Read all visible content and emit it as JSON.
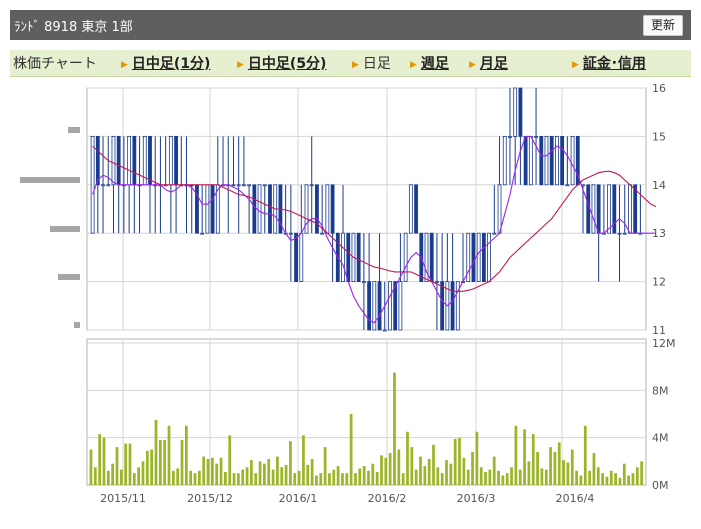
{
  "header": {
    "title": "ﾗﾝﾄﾞ 8918 東京 1部",
    "refresh_label": "更新"
  },
  "tabs": [
    {
      "label": "株価チャート",
      "link": false,
      "arrow": false
    },
    {
      "label": "日中足(1分)",
      "link": true,
      "arrow": true
    },
    {
      "label": "日中足(5分)",
      "link": true,
      "arrow": true
    },
    {
      "label": "日足",
      "link": false,
      "arrow": true
    },
    {
      "label": "週足",
      "link": true,
      "arrow": true
    },
    {
      "label": "月足",
      "link": true,
      "arrow": true
    },
    {
      "label": "証金･信用",
      "link": true,
      "arrow": true
    }
  ],
  "chart_data": [
    {
      "type": "candlestick",
      "title": "",
      "ylim": [
        11,
        16
      ],
      "y_ticks": [
        "11",
        "12",
        "13",
        "14",
        "15",
        "16"
      ],
      "grid": true,
      "colors": {
        "up": "#ffffff",
        "down": "#1a3c8e",
        "border": "#1a3c8e",
        "ma_short": "#c2185b",
        "ma_long": "#a020f0"
      },
      "candles": [
        {
          "o": 13,
          "h": 15,
          "l": 13,
          "c": 15
        },
        {
          "o": 15,
          "h": 15,
          "l": 13,
          "c": 14
        },
        {
          "o": 14,
          "h": 15,
          "l": 13,
          "c": 14
        },
        {
          "o": 14,
          "h": 15,
          "l": 14,
          "c": 14
        },
        {
          "o": 14,
          "h": 15,
          "l": 13,
          "c": 15
        },
        {
          "o": 15,
          "h": 15,
          "l": 13,
          "c": 14
        },
        {
          "o": 14,
          "h": 15,
          "l": 13,
          "c": 14
        },
        {
          "o": 14,
          "h": 15,
          "l": 13,
          "c": 15
        },
        {
          "o": 15,
          "h": 15,
          "l": 13,
          "c": 14
        },
        {
          "o": 14,
          "h": 15,
          "l": 13,
          "c": 14
        },
        {
          "o": 14,
          "h": 15,
          "l": 14,
          "c": 15
        },
        {
          "o": 15,
          "h": 15,
          "l": 13,
          "c": 14
        },
        {
          "o": 14,
          "h": 15,
          "l": 13,
          "c": 14
        },
        {
          "o": 14,
          "h": 15,
          "l": 13,
          "c": 14
        },
        {
          "o": 14,
          "h": 15,
          "l": 14,
          "c": 14
        },
        {
          "o": 14,
          "h": 15,
          "l": 13,
          "c": 15
        },
        {
          "o": 15,
          "h": 15,
          "l": 13,
          "c": 14
        },
        {
          "o": 14,
          "h": 15,
          "l": 14,
          "c": 14
        },
        {
          "o": 14,
          "h": 15,
          "l": 13,
          "c": 14
        },
        {
          "o": 14,
          "h": 14,
          "l": 13,
          "c": 14
        },
        {
          "o": 14,
          "h": 14,
          "l": 13,
          "c": 13
        },
        {
          "o": 13,
          "h": 14,
          "l": 13,
          "c": 13
        },
        {
          "o": 13,
          "h": 14,
          "l": 13,
          "c": 14
        },
        {
          "o": 14,
          "h": 14,
          "l": 13,
          "c": 13
        },
        {
          "o": 13,
          "h": 15,
          "l": 13,
          "c": 14
        },
        {
          "o": 14,
          "h": 15,
          "l": 14,
          "c": 14
        },
        {
          "o": 14,
          "h": 15,
          "l": 13,
          "c": 14
        },
        {
          "o": 14,
          "h": 15,
          "l": 14,
          "c": 14
        },
        {
          "o": 14,
          "h": 15,
          "l": 13,
          "c": 14
        },
        {
          "o": 14,
          "h": 15,
          "l": 14,
          "c": 14
        },
        {
          "o": 14,
          "h": 14,
          "l": 13,
          "c": 14
        },
        {
          "o": 14,
          "h": 14,
          "l": 13,
          "c": 13
        },
        {
          "o": 13,
          "h": 14,
          "l": 13,
          "c": 14
        },
        {
          "o": 14,
          "h": 14,
          "l": 13,
          "c": 14
        },
        {
          "o": 14,
          "h": 14,
          "l": 13,
          "c": 13
        },
        {
          "o": 13,
          "h": 14,
          "l": 13,
          "c": 14
        },
        {
          "o": 14,
          "h": 14,
          "l": 13,
          "c": 13
        },
        {
          "o": 13,
          "h": 14,
          "l": 13,
          "c": 13
        },
        {
          "o": 13,
          "h": 14,
          "l": 12,
          "c": 13
        },
        {
          "o": 13,
          "h": 13,
          "l": 12,
          "c": 12
        },
        {
          "o": 12,
          "h": 14,
          "l": 12,
          "c": 13
        },
        {
          "o": 13,
          "h": 14,
          "l": 13,
          "c": 14
        },
        {
          "o": 14,
          "h": 15,
          "l": 13,
          "c": 14
        },
        {
          "o": 14,
          "h": 14,
          "l": 13,
          "c": 13
        },
        {
          "o": 13,
          "h": 14,
          "l": 13,
          "c": 13
        },
        {
          "o": 13,
          "h": 14,
          "l": 13,
          "c": 14
        },
        {
          "o": 14,
          "h": 14,
          "l": 12,
          "c": 13
        },
        {
          "o": 13,
          "h": 13,
          "l": 12,
          "c": 12
        },
        {
          "o": 12,
          "h": 14,
          "l": 12,
          "c": 13
        },
        {
          "o": 13,
          "h": 13,
          "l": 12,
          "c": 12
        },
        {
          "o": 12,
          "h": 13,
          "l": 12,
          "c": 13
        },
        {
          "o": 13,
          "h": 13,
          "l": 12,
          "c": 12
        },
        {
          "o": 12,
          "h": 13,
          "l": 11,
          "c": 12
        },
        {
          "o": 12,
          "h": 13,
          "l": 11,
          "c": 11
        },
        {
          "o": 11,
          "h": 12,
          "l": 11,
          "c": 12
        },
        {
          "o": 12,
          "h": 13,
          "l": 11,
          "c": 11
        },
        {
          "o": 11,
          "h": 12,
          "l": 11,
          "c": 11
        },
        {
          "o": 11,
          "h": 12,
          "l": 11,
          "c": 12
        },
        {
          "o": 12,
          "h": 12,
          "l": 11,
          "c": 11
        },
        {
          "o": 11,
          "h": 13,
          "l": 11,
          "c": 12
        },
        {
          "o": 12,
          "h": 13,
          "l": 12,
          "c": 13
        },
        {
          "o": 13,
          "h": 14,
          "l": 13,
          "c": 14
        },
        {
          "o": 14,
          "h": 14,
          "l": 13,
          "c": 13
        },
        {
          "o": 13,
          "h": 13,
          "l": 12,
          "c": 12
        },
        {
          "o": 12,
          "h": 13,
          "l": 12,
          "c": 13
        },
        {
          "o": 13,
          "h": 13,
          "l": 12,
          "c": 12
        },
        {
          "o": 12,
          "h": 13,
          "l": 11,
          "c": 12
        },
        {
          "o": 12,
          "h": 13,
          "l": 11,
          "c": 11
        },
        {
          "o": 11,
          "h": 13,
          "l": 11,
          "c": 12
        },
        {
          "o": 12,
          "h": 13,
          "l": 11,
          "c": 11
        },
        {
          "o": 11,
          "h": 12,
          "l": 11,
          "c": 12
        },
        {
          "o": 12,
          "h": 13,
          "l": 12,
          "c": 12
        },
        {
          "o": 12,
          "h": 13,
          "l": 12,
          "c": 13
        },
        {
          "o": 13,
          "h": 13,
          "l": 12,
          "c": 12
        },
        {
          "o": 12,
          "h": 13,
          "l": 12,
          "c": 13
        },
        {
          "o": 13,
          "h": 13,
          "l": 12,
          "c": 12
        },
        {
          "o": 12,
          "h": 13,
          "l": 12,
          "c": 13
        },
        {
          "o": 13,
          "h": 14,
          "l": 13,
          "c": 13
        },
        {
          "o": 13,
          "h": 15,
          "l": 13,
          "c": 14
        },
        {
          "o": 14,
          "h": 15,
          "l": 14,
          "c": 15
        },
        {
          "o": 15,
          "h": 16,
          "l": 14,
          "c": 15
        },
        {
          "o": 15,
          "h": 16,
          "l": 14,
          "c": 16
        },
        {
          "o": 16,
          "h": 16,
          "l": 14,
          "c": 15
        },
        {
          "o": 15,
          "h": 15,
          "l": 14,
          "c": 14
        },
        {
          "o": 14,
          "h": 15,
          "l": 14,
          "c": 15
        },
        {
          "o": 15,
          "h": 16,
          "l": 14,
          "c": 15
        },
        {
          "o": 15,
          "h": 15,
          "l": 14,
          "c": 14
        },
        {
          "o": 14,
          "h": 15,
          "l": 14,
          "c": 15
        },
        {
          "o": 15,
          "h": 15,
          "l": 14,
          "c": 14
        },
        {
          "o": 14,
          "h": 15,
          "l": 14,
          "c": 15
        },
        {
          "o": 15,
          "h": 15,
          "l": 14,
          "c": 14
        },
        {
          "o": 14,
          "h": 15,
          "l": 14,
          "c": 14
        },
        {
          "o": 14,
          "h": 15,
          "l": 14,
          "c": 15
        },
        {
          "o": 15,
          "h": 15,
          "l": 14,
          "c": 14
        },
        {
          "o": 14,
          "h": 14,
          "l": 13,
          "c": 14
        },
        {
          "o": 14,
          "h": 14,
          "l": 13,
          "c": 13
        },
        {
          "o": 13,
          "h": 14,
          "l": 13,
          "c": 14
        },
        {
          "o": 14,
          "h": 14,
          "l": 12,
          "c": 13
        },
        {
          "o": 13,
          "h": 14,
          "l": 13,
          "c": 13
        },
        {
          "o": 13,
          "h": 14,
          "l": 13,
          "c": 14
        },
        {
          "o": 14,
          "h": 14,
          "l": 13,
          "c": 13
        },
        {
          "o": 13,
          "h": 14,
          "l": 12,
          "c": 13
        },
        {
          "o": 13,
          "h": 14,
          "l": 13,
          "c": 13
        },
        {
          "o": 13,
          "h": 14,
          "l": 13,
          "c": 14
        },
        {
          "o": 14,
          "h": 14,
          "l": 13,
          "c": 13
        },
        {
          "o": 13,
          "h": 14,
          "l": 13,
          "c": 13
        }
      ],
      "ma_short": [
        14.8,
        14.7,
        14.6,
        14.5,
        14.45,
        14.4,
        14.35,
        14.3,
        14.25,
        14.2,
        14.15,
        14.1,
        14.05,
        14.0,
        14.0,
        14.0,
        14.0,
        14.0,
        14.0,
        14.0,
        14.0,
        14.0,
        14.0,
        14.0,
        14.0,
        13.95,
        13.9,
        13.85,
        13.8,
        13.78,
        13.75,
        13.7,
        13.65,
        13.6,
        13.55,
        13.5,
        13.5,
        13.48,
        13.45,
        13.4,
        13.35,
        13.3,
        13.25,
        13.2,
        13.1,
        13.0,
        12.9,
        12.8,
        12.7,
        12.6,
        12.5,
        12.45,
        12.4,
        12.35,
        12.3,
        12.28,
        12.25,
        12.22,
        12.2,
        12.2,
        12.2,
        12.2,
        12.15,
        12.1,
        12.05,
        12.0,
        11.95,
        11.9,
        11.85,
        11.8,
        11.8,
        11.8,
        11.82,
        11.85,
        11.9,
        11.95,
        12.0,
        12.1,
        12.2,
        12.35,
        12.5,
        12.6,
        12.7,
        12.8,
        12.9,
        13.0,
        13.1,
        13.2,
        13.3,
        13.45,
        13.6,
        13.75,
        13.9,
        14.0,
        14.1,
        14.15,
        14.2,
        14.25,
        14.27,
        14.28,
        14.25,
        14.2,
        14.1,
        14.0,
        13.9,
        13.8,
        13.7,
        13.6,
        13.55
      ],
      "ma_long": [
        13.8,
        14.1,
        14.2,
        14.15,
        14.05,
        14.0,
        14.0,
        14.0,
        14.0,
        14.0,
        14.0,
        14.0,
        14.0,
        14.0,
        13.9,
        13.85,
        13.9,
        14.0,
        14.0,
        13.95,
        13.8,
        13.6,
        13.6,
        13.7,
        13.9,
        14.0,
        14.0,
        13.95,
        13.9,
        13.8,
        13.7,
        13.55,
        13.45,
        13.4,
        13.4,
        13.35,
        13.2,
        13.0,
        12.85,
        12.9,
        13.0,
        13.2,
        13.3,
        13.3,
        13.15,
        12.9,
        12.7,
        12.5,
        12.35,
        12.0,
        11.7,
        11.5,
        11.35,
        11.2,
        11.15,
        11.3,
        11.5,
        11.7,
        11.9,
        12.1,
        12.3,
        12.5,
        12.6,
        12.5,
        12.2,
        12.0,
        11.8,
        11.6,
        11.5,
        11.6,
        11.8,
        12.0,
        12.2,
        12.4,
        12.6,
        12.7,
        12.8,
        12.9,
        13.0,
        13.4,
        13.8,
        14.3,
        14.7,
        15.0,
        15.0,
        14.8,
        14.6,
        14.6,
        14.7,
        14.8,
        14.75,
        14.6,
        14.4,
        14.2,
        13.9,
        13.6,
        13.3,
        13.0,
        13.0,
        13.1,
        13.2,
        13.3,
        13.2,
        13.0,
        13.0,
        13.0,
        13.0,
        13.0,
        13.0
      ]
    },
    {
      "type": "bar",
      "title": "",
      "ylim": [
        0,
        12
      ],
      "y_ticks": [
        "0M",
        "4M",
        "8M",
        "12M"
      ],
      "grid": true,
      "bar_color": "#9bb529",
      "x_labels": [
        "2015/11",
        "2015/12",
        "2016/1",
        "2016/2",
        "2016/3",
        "2016/4"
      ],
      "values": [
        3.0,
        1.5,
        4.3,
        4.0,
        1.2,
        1.8,
        3.2,
        1.3,
        3.5,
        3.5,
        1.0,
        1.5,
        2.0,
        2.9,
        3.0,
        5.5,
        3.8,
        3.8,
        5.0,
        1.2,
        1.4,
        3.8,
        5.0,
        1.2,
        1.0,
        1.2,
        2.4,
        2.2,
        2.3,
        1.8,
        2.3,
        1.1,
        4.2,
        1.0,
        1.0,
        1.3,
        1.5,
        2.1,
        1.0,
        2.0,
        1.8,
        2.2,
        1.3,
        2.4,
        1.5,
        1.7,
        3.7,
        1.0,
        1.2,
        4.2,
        1.7,
        2.2,
        0.8,
        1.0,
        3.2,
        1.0,
        1.3,
        1.6,
        1.0,
        1.0,
        6.0,
        1.0,
        1.4,
        1.6,
        1.2,
        1.8,
        1.1,
        2.5,
        2.3,
        2.7,
        9.5,
        3.0,
        1.0,
        4.5,
        3.2,
        1.3,
        2.4,
        1.6,
        2.2,
        3.4,
        1.5,
        1.0,
        2.1,
        1.8,
        3.9,
        4.0,
        2.3,
        1.3,
        2.8,
        4.5,
        1.5,
        1.1,
        1.3,
        2.4,
        1.2,
        0.8,
        1.0,
        1.5,
        5.0,
        1.3,
        4.7,
        2.0,
        4.3,
        2.8,
        1.4,
        1.3,
        3.2,
        2.8,
        3.6,
        2.1,
        1.9,
        3.0,
        1.2,
        0.8,
        5.0,
        1.2,
        2.7,
        1.5,
        1.0,
        0.7,
        1.2,
        1.0,
        0.6,
        1.8,
        0.8,
        1.0,
        1.5,
        2.0
      ]
    }
  ]
}
